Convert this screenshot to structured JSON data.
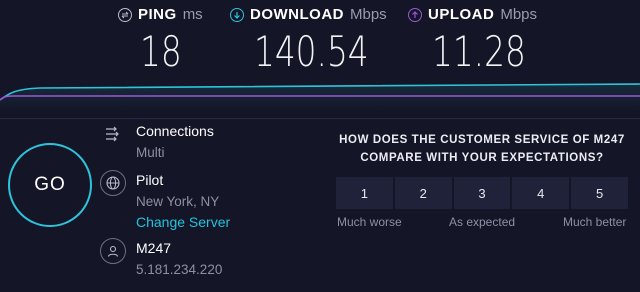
{
  "metrics": {
    "ping": {
      "label": "PING",
      "unit": "ms",
      "value": "18",
      "icon": "ping-icon"
    },
    "download": {
      "label": "DOWNLOAD",
      "unit": "Mbps",
      "value": "140.54",
      "icon": "download-icon"
    },
    "upload": {
      "label": "UPLOAD",
      "unit": "Mbps",
      "value": "11.28",
      "icon": "upload-icon"
    }
  },
  "colors": {
    "background": "#141526",
    "download": "#2fc3d9",
    "upload": "#9b57d6",
    "link": "#1fc4de"
  },
  "go_button": {
    "label": "GO"
  },
  "connections": {
    "title": "Connections",
    "value": "Multi",
    "icon": "connections-icon"
  },
  "server": {
    "title": "Pilot",
    "location": "New York, NY",
    "change_link": "Change Server",
    "icon": "globe-icon"
  },
  "host": {
    "name": "M247",
    "ip": "5.181.234.220",
    "icon": "user-icon"
  },
  "survey": {
    "question_line1": "HOW DOES THE CUSTOMER SERVICE OF M247",
    "question_line2": "COMPARE WITH YOUR EXPECTATIONS?",
    "options": [
      "1",
      "2",
      "3",
      "4",
      "5"
    ],
    "scale_low": "Much worse",
    "scale_mid": "As expected",
    "scale_high": "Much better"
  }
}
